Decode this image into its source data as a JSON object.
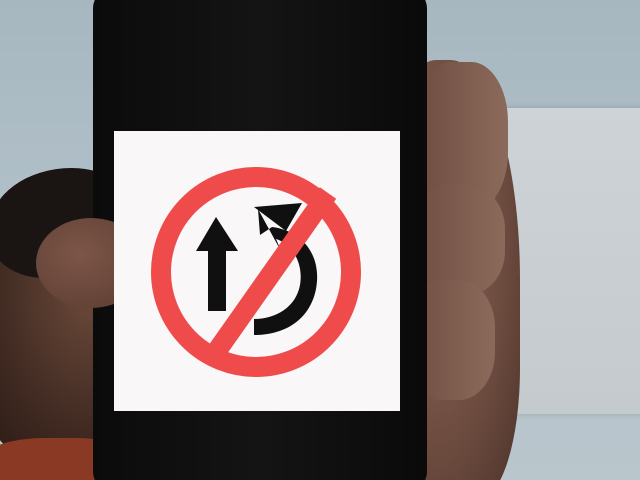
{
  "photo": {
    "subject": "phone-screen-sign",
    "sign_icon": "no-straight-or-u-turn-sign-icon",
    "colors": {
      "ring": "#ef4b4b",
      "arrows": "#101010",
      "screen": "#f9f7f8",
      "phone": "#0d0d0d"
    }
  }
}
